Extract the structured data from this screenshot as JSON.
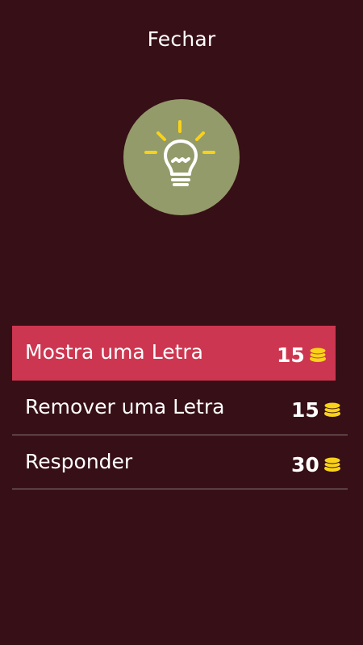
{
  "header": {
    "close_label": "Fechar"
  },
  "hint_icon": "lightbulb-icon",
  "colors": {
    "background": "#370f16",
    "circle": "#949b6a",
    "selected": "#cd3650",
    "coin": "#f8d21a",
    "bulb_rays": "#f8d21a"
  },
  "options": [
    {
      "label": "Mostra uma Letra",
      "cost": "15",
      "icon": "coins-icon"
    },
    {
      "label": "Remover uma Letra",
      "cost": "15",
      "icon": "coins-icon"
    },
    {
      "label": "Responder",
      "cost": "30",
      "icon": "coins-icon"
    }
  ]
}
